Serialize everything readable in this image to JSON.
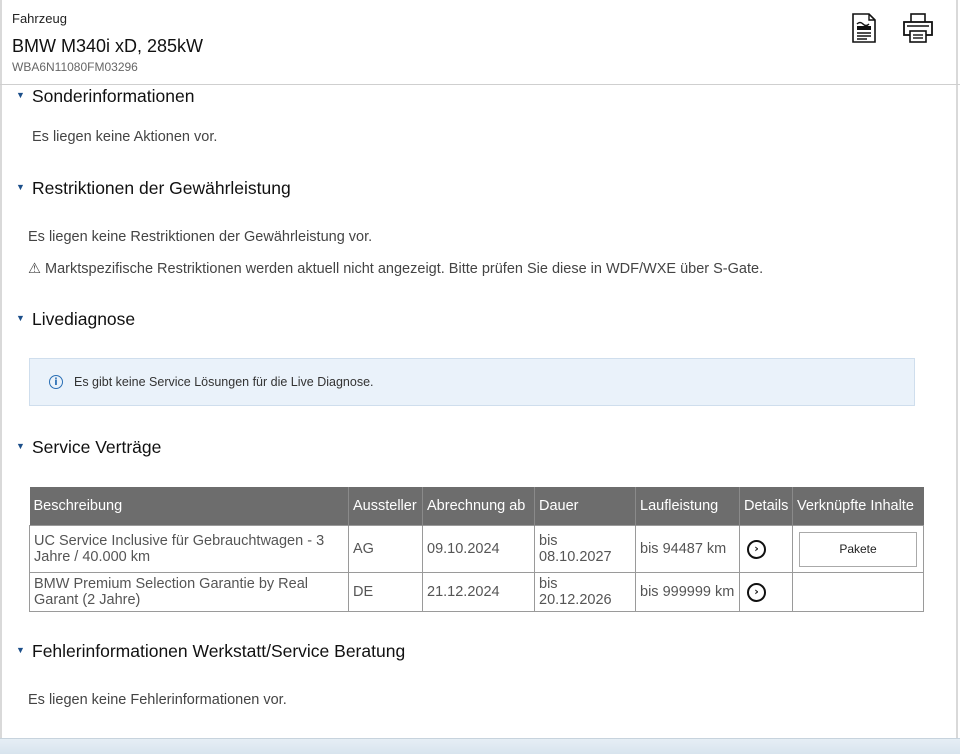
{
  "header": {
    "label": "Fahrzeug",
    "model": "BMW M340i xD, 285kW",
    "vin": "WBA6N11080FM03296",
    "icons": [
      "document-icon",
      "printer-icon"
    ]
  },
  "sections": {
    "sonder": {
      "title": "Sonderinformationen",
      "text": "Es liegen keine Aktionen vor."
    },
    "restriktionen": {
      "title": "Restriktionen der Gewährleistung",
      "text": "Es liegen keine Restriktionen der Gewährleistung vor.",
      "warning": "⚠ Marktspezifische Restriktionen werden aktuell nicht angezeigt. Bitte prüfen Sie diese in WDF/WXE über S-Gate."
    },
    "livediagnose": {
      "title": "Livediagnose",
      "info": "Es gibt keine Service Lösungen für die Live Diagnose."
    },
    "vertraege": {
      "title": "Service Verträge",
      "columns": [
        "Beschreibung",
        "Aussteller",
        "Abrechnung ab",
        "Dauer",
        "Laufleistung",
        "Details",
        "Verknüpfte Inhalte"
      ],
      "rows": [
        {
          "beschreibung": "UC Service Inclusive für Gebrauchtwagen - 3 Jahre / 40.000 km",
          "aussteller": "AG",
          "abrechnung": "09.10.2024",
          "dauer": "bis 08.10.2027",
          "laufleistung": "bis 94487 km",
          "inhalte": "Pakete"
        },
        {
          "beschreibung": "BMW Premium Selection Garantie by Real Garant (2 Jahre)",
          "aussteller": "DE",
          "abrechnung": "21.12.2024",
          "dauer": "bis 20.12.2026",
          "laufleistung": "bis 999999 km",
          "inhalte": ""
        }
      ]
    },
    "fehler": {
      "title": "Fehlerinformationen Werkstatt/Service Beratung",
      "text": "Es liegen keine Fehlerinformationen vor."
    }
  }
}
